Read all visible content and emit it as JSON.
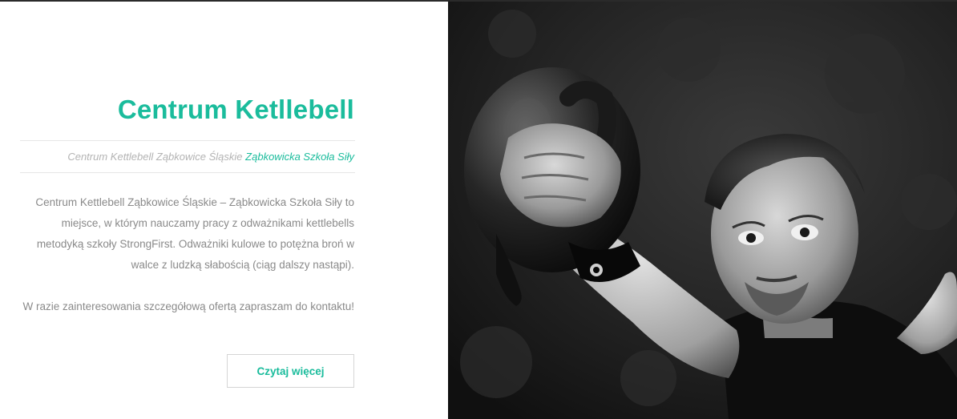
{
  "section": {
    "title": "Centrum Ketllebell",
    "subtitle_plain": "Centrum Kettlebell Ząbkowice Śląskie",
    "subtitle_accent": "Ząbkowicka Szkoła Siły",
    "paragraph1": "Centrum Kettlebell Ząbkowice Śląskie – Ząbkowicka Szkoła Siły to miejsce, w którym nauczamy pracy z odważnikami kettlebells metodyką szkoły StrongFirst. Odważniki kulowe to potężna broń w walce z ludzką słabością (ciąg dalszy nastąpi).",
    "paragraph2": "W razie zainteresowania szczegółową ofertą zapraszam do kontaktu!",
    "button_label": "Czytaj więcej",
    "accent_color": "#1abc9c"
  },
  "photo": {
    "subject": "black-and-white photo of a man swinging a kettlebell",
    "style": "monochrome"
  }
}
